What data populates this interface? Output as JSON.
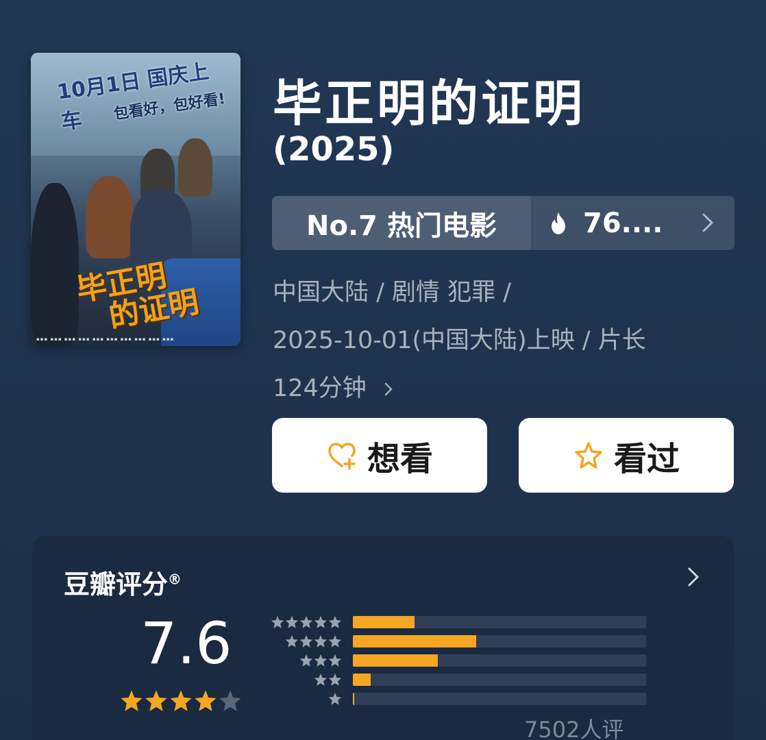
{
  "movie": {
    "title": "毕正明的证明",
    "year": "(2025)"
  },
  "poster": {
    "banner_top": "10月1日 国庆上车",
    "banner_sub": "包看好，包好看!",
    "title_art_line1": "毕正明",
    "title_art_line2": "的证明"
  },
  "rank": {
    "label": "No.7 热门电影",
    "heat": "76....",
    "icon": "flame-icon"
  },
  "meta": {
    "line1": "中国大陆 / 剧情 犯罪 /",
    "line2": "2025-10-01(中国大陆)上映 / 片长",
    "line3": "124分钟"
  },
  "actions": {
    "want_label": "想看",
    "seen_label": "看过"
  },
  "rating": {
    "title": "豆瓣评分",
    "registered_mark": "®",
    "score": "7.6",
    "stars": 4,
    "count_text": "7502人评",
    "distribution": [
      {
        "stars": 5,
        "fraction": 0.21
      },
      {
        "stars": 4,
        "fraction": 0.42
      },
      {
        "stars": 3,
        "fraction": 0.29
      },
      {
        "stars": 2,
        "fraction": 0.06
      },
      {
        "stars": 1,
        "fraction": 0.005
      }
    ]
  },
  "colors": {
    "background": "#1f3350",
    "accent_orange": "#f5a623",
    "card_bg": "#1a2a40"
  }
}
